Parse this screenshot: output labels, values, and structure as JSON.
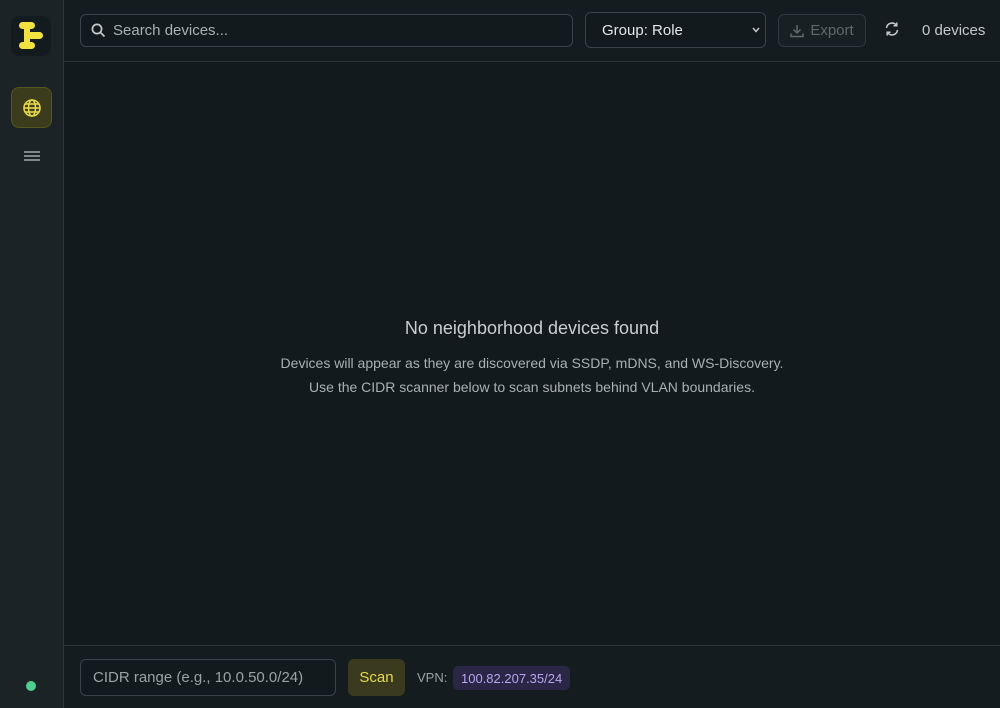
{
  "sidebar": {
    "logo_icon": "stacked-pills-logo",
    "items": [
      {
        "name": "globe",
        "icon": "globe-icon",
        "active": true
      },
      {
        "name": "list",
        "icon": "list-icon",
        "active": false
      }
    ],
    "status_color": "#4fcf8e"
  },
  "toolbar": {
    "search_placeholder": "Search devices...",
    "group_label": "Group: Role",
    "export_label": "Export",
    "device_count": "0 devices"
  },
  "empty_state": {
    "title": "No neighborhood devices found",
    "line1": "Devices will appear as they are discovered via SSDP, mDNS, and WS-Discovery.",
    "line2": "Use the CIDR scanner below to scan subnets behind VLAN boundaries."
  },
  "scanner": {
    "cidr_placeholder": "CIDR range (e.g., 10.0.50.0/24)",
    "scan_label": "Scan",
    "vpn_label": "VPN:",
    "vpn_value": "100.82.207.35/24"
  },
  "colors": {
    "accent": "#e8d84a",
    "background": "#121a1d",
    "vpn_badge": "#2b2646",
    "vpn_text": "#b7a6ee"
  }
}
